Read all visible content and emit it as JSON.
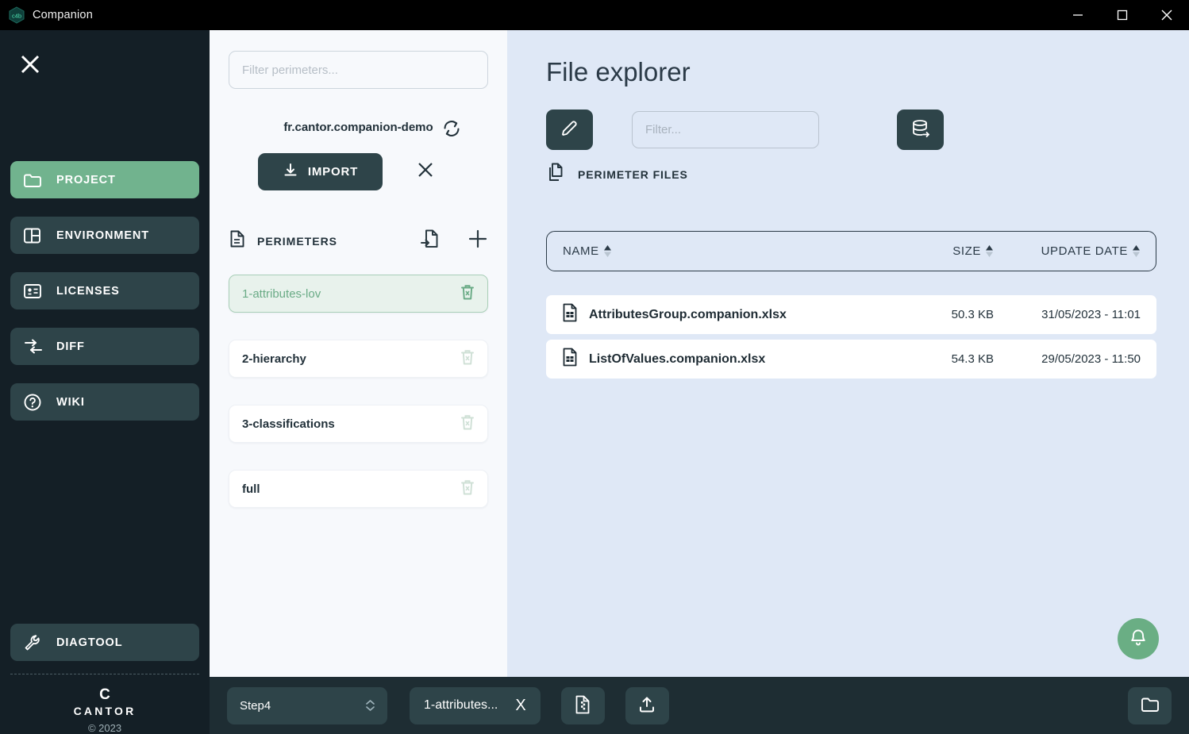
{
  "window": {
    "title": "Companion",
    "logo_text": "c4b",
    "controls": {
      "minimize": "minimize-icon",
      "maximize": "maximize-icon",
      "close": "close-icon"
    }
  },
  "sidebar": {
    "close_icon": "close-icon",
    "items": [
      {
        "label": "PROJECT",
        "icon": "folder-icon",
        "active": true
      },
      {
        "label": "ENVIRONMENT",
        "icon": "layout-icon",
        "active": false
      },
      {
        "label": "LICENSES",
        "icon": "id-card-icon",
        "active": false
      },
      {
        "label": "DIFF",
        "icon": "diff-arrows-icon",
        "active": false
      },
      {
        "label": "WIKI",
        "icon": "question-circle-icon",
        "active": false
      }
    ],
    "diagtool": {
      "label": "DIAGTOOL",
      "icon": "wrench-icon"
    },
    "footer": {
      "brand_mark": "C",
      "brand": "CANTOR",
      "copyright": "© 2023"
    }
  },
  "perimeters_panel": {
    "filter": {
      "value": "",
      "placeholder": "Filter perimeters..."
    },
    "project_name": "fr.cantor.companion-demo",
    "refresh_icon": "refresh-icon",
    "import_label": "IMPORT",
    "import_icon": "download-icon",
    "cancel_icon": "close-icon",
    "section_title": "PERIMETERS",
    "section_icon": "document-list-icon",
    "actions": {
      "import_file_icon": "file-import-icon",
      "add_icon": "plus-icon"
    },
    "items": [
      {
        "name": "1-attributes-lov",
        "selected": true
      },
      {
        "name": "2-hierarchy",
        "selected": false
      },
      {
        "name": "3-classifications",
        "selected": false
      },
      {
        "name": "full",
        "selected": false
      }
    ],
    "delete_icon": "trash-icon"
  },
  "main": {
    "title": "File explorer",
    "edit_icon": "pencil-icon",
    "filter": {
      "value": "",
      "placeholder": "Filter..."
    },
    "database_icon": "database-export-icon",
    "perimeter_files": {
      "label": "PERIMETER FILES",
      "icon": "copy-files-icon"
    },
    "table": {
      "columns": [
        {
          "label": "NAME",
          "sort": "asc"
        },
        {
          "label": "SIZE",
          "sort": "none"
        },
        {
          "label": "UPDATE DATE",
          "sort": "none"
        }
      ],
      "rows": [
        {
          "icon": "xlsx-file-icon",
          "name": "AttributesGroup.companion.xlsx",
          "size": "50.3 KB",
          "date": "31/05/2023 - 11:01"
        },
        {
          "icon": "xlsx-file-icon",
          "name": "ListOfValues.companion.xlsx",
          "size": "54.3 KB",
          "date": "29/05/2023 - 11:50"
        }
      ]
    },
    "notification_icon": "bell-icon"
  },
  "bottombar": {
    "step": {
      "value": "Step4",
      "caret_icon": "chevron-updown-icon"
    },
    "chip": {
      "label": "1-attributes...",
      "close": "X"
    },
    "zip_icon": "zip-file-icon",
    "upload_icon": "upload-icon",
    "folder_icon": "folder-icon"
  },
  "colors": {
    "accent_green": "#71b38e",
    "dark_teal": "#2e4449",
    "sidebar_bg": "#141f26",
    "main_bg": "#dfe8f6",
    "panel_bg": "#f7f9fc",
    "bottombar_bg": "#1e2d33"
  }
}
